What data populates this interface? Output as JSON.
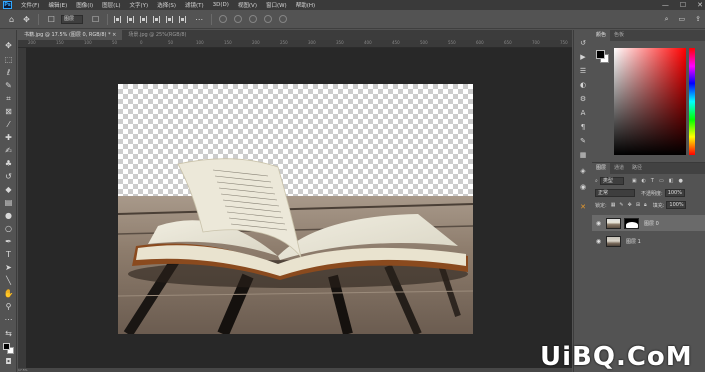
{
  "menubar": {
    "logo": "Ps",
    "items": [
      "文件(F)",
      "编辑(E)",
      "图像(I)",
      "图层(L)",
      "文字(Y)",
      "选择(S)",
      "滤镜(T)",
      "3D(D)",
      "视图(V)",
      "窗口(W)",
      "帮助(H)"
    ],
    "window_controls": [
      "—",
      "☐",
      "✕"
    ]
  },
  "options": {
    "auto_select_value": "图层",
    "right_icons": [
      "search-icon",
      "workspace-icon",
      "share-icon"
    ]
  },
  "document_tabs": [
    {
      "label": "书籍.jpg @ 17.5% (图层 0, RGB/8) * ×",
      "active": true
    },
    {
      "label": "场景.jpg @ 25%(RGB/8)",
      "active": false
    }
  ],
  "ruler": {
    "ticks": [
      "200",
      "150",
      "100",
      "50",
      "0",
      "50",
      "100",
      "150",
      "200",
      "250",
      "300",
      "350",
      "400",
      "450",
      "500",
      "550",
      "600",
      "650",
      "700",
      "750"
    ]
  },
  "panels": {
    "color_tabs": [
      "颜色",
      "色板"
    ],
    "layers_tabs": [
      "图层",
      "通道",
      "路径"
    ],
    "filter_kind": "类型",
    "blend_mode": "正常",
    "opacity_label": "不透明度:",
    "opacity_value": "100%",
    "lock_label": "锁定:",
    "fill_label": "填充:",
    "fill_value": "100%",
    "layers": [
      {
        "name": "图层 0",
        "selected": true
      },
      {
        "name": "图层 1",
        "selected": false
      }
    ]
  },
  "status": {
    "zoom": "17.5%"
  },
  "watermark": "UiBQ.CoM"
}
